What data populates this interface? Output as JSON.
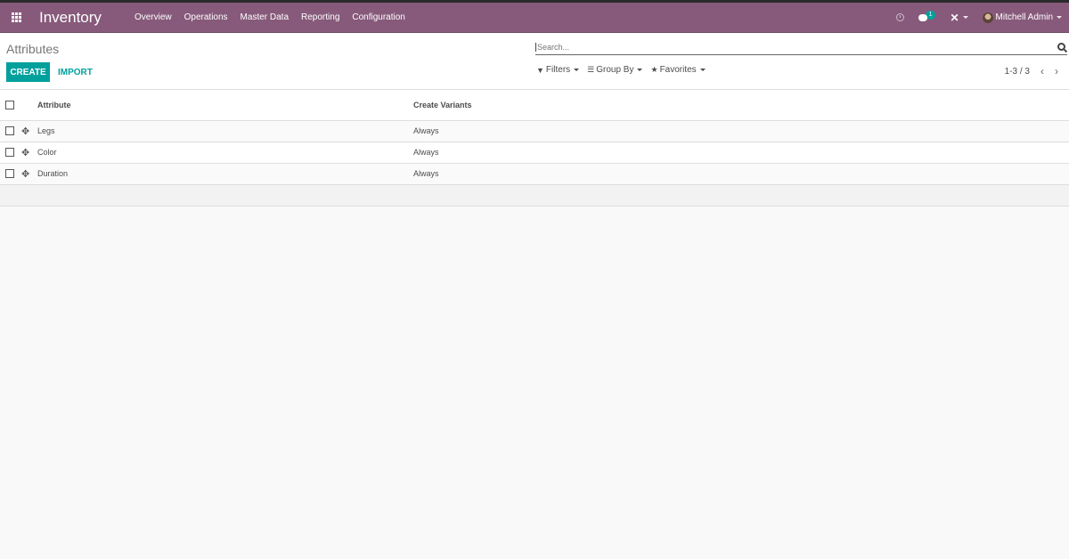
{
  "navbar": {
    "app_name": "Inventory",
    "menu": [
      "Overview",
      "Operations",
      "Master Data",
      "Reporting",
      "Configuration"
    ],
    "chat_badge": "1",
    "user_name": "Mitchell Admin",
    "color": "#875a7b"
  },
  "control_panel": {
    "breadcrumb": "Attributes",
    "create_label": "CREATE",
    "import_label": "IMPORT",
    "search_placeholder": "Search...",
    "filters_label": "Filters",
    "groupby_label": "Group By",
    "favorites_label": "Favorites",
    "pager": "1-3 / 3",
    "accent": "#00a09d"
  },
  "list": {
    "columns": [
      "Attribute",
      "Create Variants"
    ],
    "rows": [
      {
        "attribute": "Legs",
        "create_variants": "Always"
      },
      {
        "attribute": "Color",
        "create_variants": "Always"
      },
      {
        "attribute": "Duration",
        "create_variants": "Always"
      }
    ]
  }
}
